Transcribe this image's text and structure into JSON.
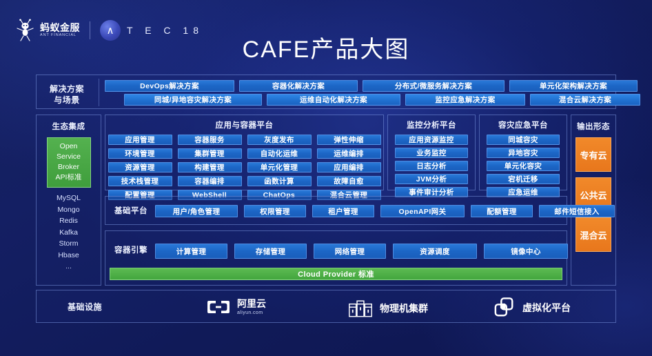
{
  "header": {
    "brand_cn": "蚂蚁金服",
    "brand_en": "ANT FINANCIAL",
    "atec_glyph": "∧",
    "atec_text": "T E C  18",
    "title": "CAFE产品大图"
  },
  "solutions": {
    "label": "解决方案\n与场景",
    "label_line1": "解决方案",
    "label_line2": "与场景",
    "row1": [
      "DevOps解决方案",
      "容器化解决方案",
      "分布式/微服务解决方案",
      "单元化架构解决方案"
    ],
    "row2": [
      "同城/异地容灾解决方案",
      "运维自动化解决方案",
      "监控应急解决方案",
      "混合云解决方案"
    ]
  },
  "ecosystem": {
    "title": "生态集成",
    "green_lines": [
      "Open",
      "Service",
      "Broker",
      "API标准"
    ],
    "items": [
      "MySQL",
      "Mongo",
      "Redis",
      "Kafka",
      "Storm",
      "Hbase",
      "..."
    ]
  },
  "app_container_platform": {
    "title": "应用与容器平台",
    "items": [
      "应用管理",
      "容器服务",
      "灰度发布",
      "弹性伸缩",
      "环境管理",
      "集群管理",
      "自动化运维",
      "运维编排",
      "资源管理",
      "构建管理",
      "单元化管理",
      "应用编排",
      "技术栈管理",
      "容器编排",
      "函数计算",
      "故障自愈",
      "配置管理",
      "WebShell",
      "ChatOps",
      "混合云管理"
    ]
  },
  "monitor_platform": {
    "title": "监控分析平台",
    "items": [
      "应用资源监控",
      "业务监控",
      "日志分析",
      "JVM分析",
      "事件审计分析"
    ]
  },
  "dr_platform": {
    "title": "容灾应急平台",
    "items": [
      "同城容灾",
      "异地容灾",
      "单元化容灾",
      "宕机迁移",
      "应急运维"
    ]
  },
  "output_forms": {
    "title": "输出形态",
    "items": [
      "专有云",
      "公共云",
      "混合云"
    ]
  },
  "base_platform": {
    "label": "基础平台",
    "items": [
      "用户/角色管理",
      "权限管理",
      "租户管理",
      "OpenAPI网关",
      "配额管理",
      "邮件短信接入"
    ]
  },
  "container_engine": {
    "label": "容器引擎",
    "items": [
      "计算管理",
      "存储管理",
      "网络管理",
      "资源调度",
      "镜像中心"
    ],
    "cloud_provider_bar": "Cloud Provider 标准"
  },
  "infrastructure": {
    "label": "基础设施",
    "items": [
      {
        "name": "阿里云",
        "sub": "aliyun.com",
        "icon": "aliyun-icon"
      },
      {
        "name": "物理机集群",
        "sub": "",
        "icon": "server-rack-icon"
      },
      {
        "name": "虚拟化平台",
        "sub": "",
        "icon": "vmware-icon"
      }
    ]
  },
  "colors": {
    "background": "#101a5e",
    "chip_blue": "#1c66c6",
    "accent_green": "#43a63e",
    "accent_orange": "#e8771c",
    "border": "#96b4ff"
  }
}
